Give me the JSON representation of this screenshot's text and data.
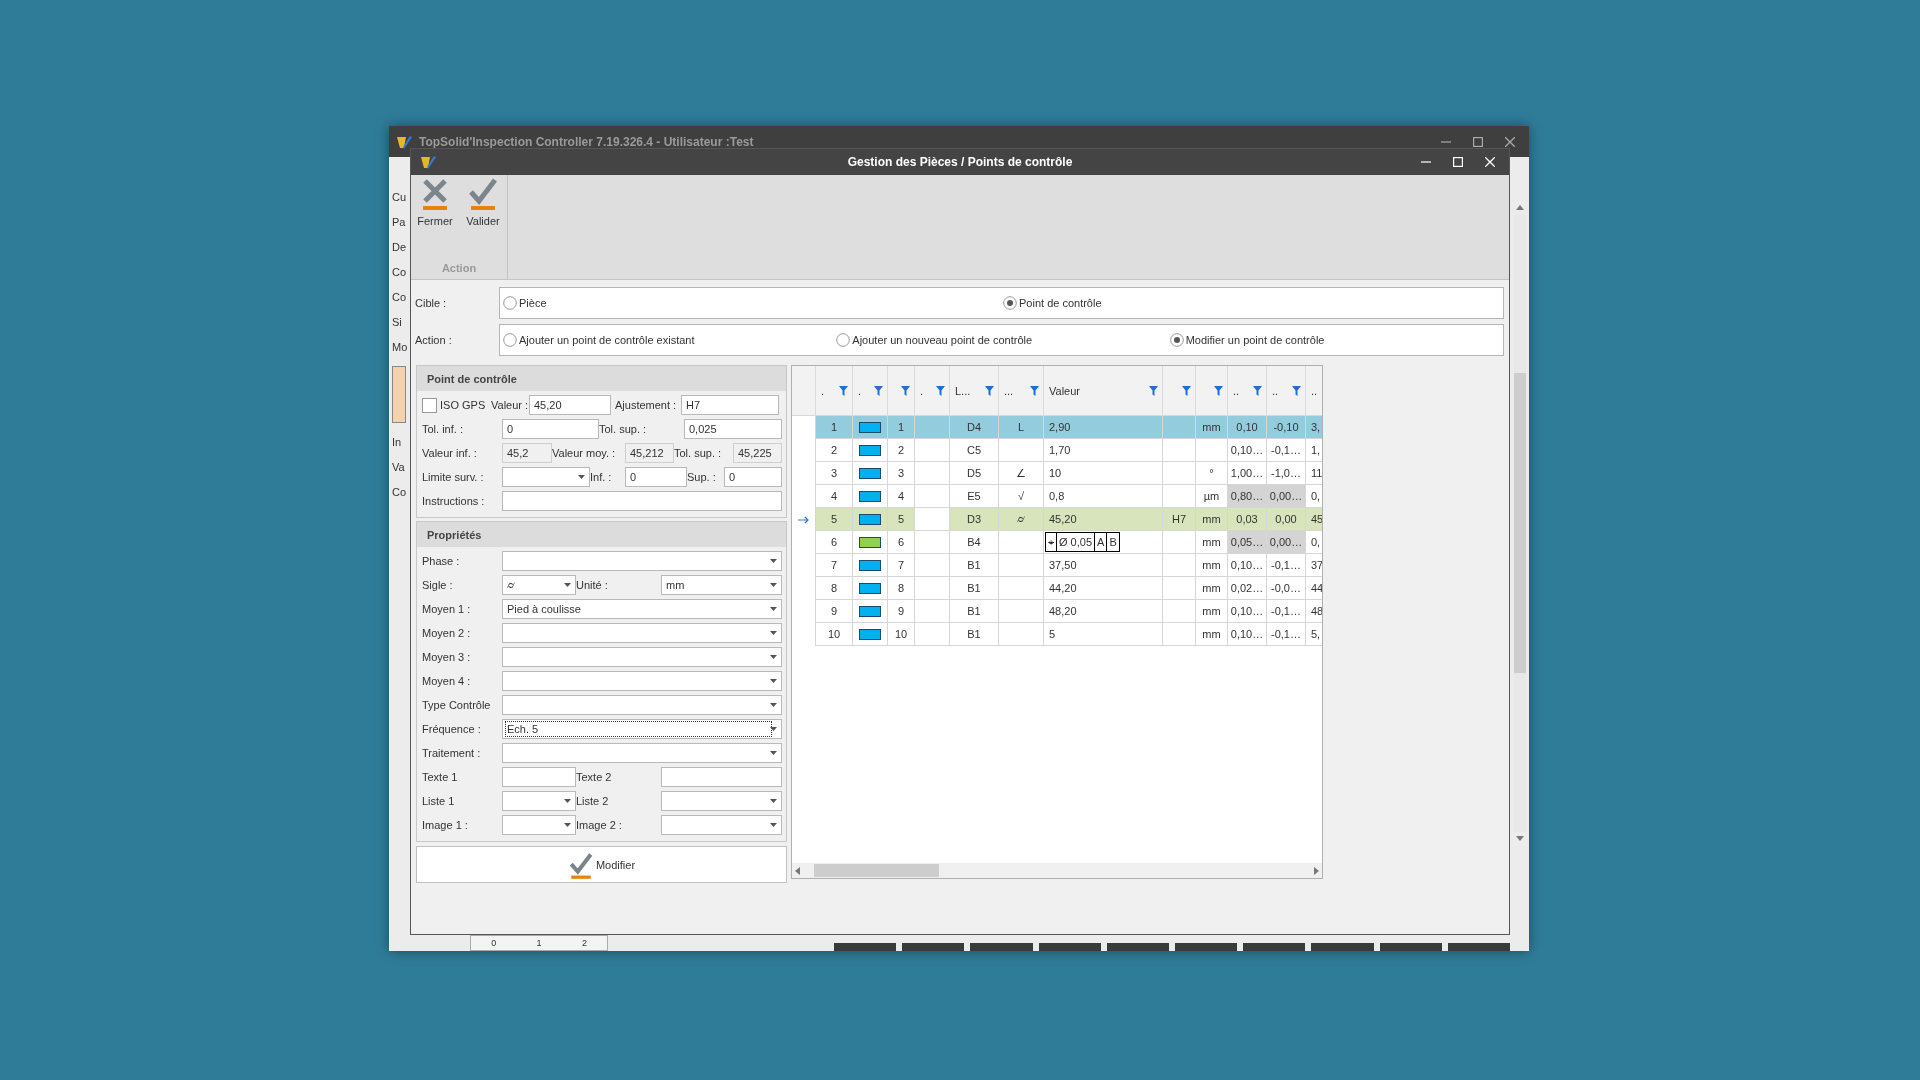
{
  "background_window": {
    "title": "TopSolid'Inspection Controller 7.19.326.4 - Utilisateur :Test",
    "side_labels": [
      "Cu",
      "Pa",
      "De",
      "Co",
      "Co",
      "Si",
      "Mo",
      "In",
      "Va",
      "Co"
    ],
    "ruler_labels": [
      "0",
      "1",
      "2"
    ]
  },
  "dialog": {
    "title": "Gestion des Pièces / Points de contrôle"
  },
  "ribbon": {
    "group": "Action",
    "buttons": [
      {
        "kind": "close",
        "label": "Fermer"
      },
      {
        "kind": "check",
        "label": "Valider"
      }
    ]
  },
  "target": {
    "label": "Cible :",
    "options": [
      {
        "label": "Pièce",
        "selected": false
      },
      {
        "label": "Point de contrôle",
        "selected": true
      }
    ]
  },
  "action": {
    "label": "Action :",
    "options": [
      {
        "label": "Ajouter un point de contrôle existant",
        "selected": false
      },
      {
        "label": "Ajouter un nouveau point de contrôle",
        "selected": false
      },
      {
        "label": "Modifier un point de contrôle",
        "selected": true
      }
    ]
  },
  "control_point": {
    "title": "Point de contrôle",
    "rows": [
      {
        "fields": [
          {
            "kind": "checkbox",
            "label": "ISO GPS",
            "checked": false
          },
          {
            "kind": "input",
            "label": "Valeur :",
            "value": "45,20"
          },
          {
            "kind": "input",
            "label": "Ajustement :",
            "value": "H7"
          }
        ]
      },
      {
        "fields": [
          {
            "kind": "input",
            "label": "Tol. inf. :",
            "value": "0"
          },
          {
            "kind": "input",
            "label": "Tol. sup. :",
            "value": "0,025"
          }
        ]
      },
      {
        "fields": [
          {
            "kind": "readonly",
            "label": "Valeur inf. :",
            "value": "45,2"
          },
          {
            "kind": "readonly",
            "label": "Valeur moy. :",
            "value": "45,212"
          },
          {
            "kind": "readonly",
            "label": "Tol. sup. :",
            "value": "45,225"
          }
        ]
      },
      {
        "fields": [
          {
            "kind": "combo",
            "label": "Limite surv. :"
          },
          {
            "kind": "input",
            "label": "Inf. :",
            "value": "0"
          },
          {
            "kind": "input",
            "label": "Sup. :",
            "value": "0"
          }
        ]
      },
      {
        "fields": [
          {
            "kind": "input",
            "label": "Instructions :"
          }
        ]
      }
    ]
  },
  "properties": {
    "title": "Propriétés",
    "rows": [
      {
        "fields": [
          {
            "kind": "combo",
            "label": "Phase :",
            "focused": false
          }
        ]
      },
      {
        "fields": [
          {
            "kind": "combo",
            "label": "Sigle :",
            "value": "⌭",
            "focused": false
          },
          {
            "kind": "combo",
            "label": "Unité :",
            "value": "mm",
            "focused": false
          }
        ]
      },
      {
        "fields": [
          {
            "kind": "combo",
            "label": "Moyen 1 :",
            "value": "Pied à coulisse",
            "focused": false
          }
        ]
      },
      {
        "fields": [
          {
            "kind": "combo",
            "label": "Moyen 2 :",
            "focused": false
          }
        ]
      },
      {
        "fields": [
          {
            "kind": "combo",
            "label": "Moyen 3 :",
            "focused": false
          }
        ]
      },
      {
        "fields": [
          {
            "kind": "combo",
            "label": "Moyen 4 :",
            "focused": false
          }
        ]
      },
      {
        "fields": [
          {
            "kind": "combo",
            "label": "Type Contrôle",
            "focused": false
          }
        ]
      },
      {
        "fields": [
          {
            "kind": "combo",
            "label": "Fréquence :",
            "value": "Ech. 5",
            "focused": true
          }
        ]
      },
      {
        "fields": [
          {
            "kind": "combo",
            "label": "Traitement :",
            "focused": false
          }
        ]
      },
      {
        "fields": [
          {
            "kind": "input",
            "label": "Texte 1",
            "focused": false
          },
          {
            "kind": "input",
            "label": "Texte 2",
            "focused": false
          }
        ]
      },
      {
        "fields": [
          {
            "kind": "combo",
            "label": "Liste 1",
            "focused": false
          },
          {
            "kind": "combo",
            "label": "Liste 2",
            "focused": false
          }
        ]
      },
      {
        "fields": [
          {
            "kind": "combo",
            "label": "Image 1 :",
            "focused": false
          },
          {
            "kind": "combo",
            "label": "Image 2 :",
            "focused": false
          }
        ]
      }
    ]
  },
  "modify_button": {
    "label": "Modifier"
  },
  "table": {
    "columns": [
      {
        "label": ".",
        "filter": true
      },
      {
        "label": ".",
        "filter": true
      },
      {
        "filter": true
      },
      {
        "label": ".",
        "filter": true
      },
      {
        "label": "L...",
        "filter": true
      },
      {
        "label": "...",
        "filter": true
      },
      {
        "label": "Valeur",
        "filter": true
      },
      {
        "filter": true
      },
      {
        "filter": true
      },
      {
        "label": "..",
        "filter": true
      },
      {
        "label": "..",
        "filter": true
      },
      {
        "label": "..",
        "filter": false
      }
    ],
    "rows": [
      {
        "kind": "text",
        "index": "1",
        "color": "#00b0f0",
        "number": "1",
        "location": "D4",
        "symbol": "L",
        "value": "2,90",
        "unit": "mm",
        "column_10": "0,10",
        "column_11": "-0,10",
        "column_12": "3,",
        "selected": true,
        "current": false,
        "grayed": false
      },
      {
        "kind": "text",
        "index": "2",
        "color": "#00b0f0",
        "number": "2",
        "location": "C5",
        "value": "1,70",
        "column_10": "0,10…",
        "column_11": "-0,1…",
        "column_12": "1,",
        "selected": false,
        "current": false,
        "grayed": false
      },
      {
        "kind": "text",
        "index": "3",
        "color": "#00b0f0",
        "number": "3",
        "location": "D5",
        "symbol": "∠",
        "value": "10",
        "unit": "°",
        "column_10": "1,00…",
        "column_11": "-1,0…",
        "column_12": "11",
        "selected": false,
        "current": false,
        "grayed": false
      },
      {
        "kind": "text",
        "index": "4",
        "color": "#00b0f0",
        "number": "4",
        "location": "E5",
        "symbol": "√",
        "value": "0,8",
        "unit": "µm",
        "column_10": "0,80…",
        "column_11": "0,00…",
        "column_12": "0,",
        "selected": false,
        "current": false,
        "grayed": true
      },
      {
        "kind": "text",
        "index": "5",
        "color": "#00b0f0",
        "number": "5",
        "location": "D3",
        "symbol": "⌭",
        "value": "45,20",
        "fit": "H7",
        "unit": "mm",
        "column_10": "0,03",
        "column_11": "0,00",
        "column_12": "45",
        "selected": false,
        "current": true,
        "grayed": false
      },
      {
        "kind": "frame",
        "index": "6",
        "color": "#92d050",
        "number": "6",
        "location": "B4",
        "frame": [
          "⌖",
          "Ø 0,05",
          "A",
          "B"
        ],
        "unit": "mm",
        "column_10": "0,05…",
        "column_11": "0,00…",
        "column_12": "0,",
        "selected": false,
        "current": false,
        "grayed": true
      },
      {
        "kind": "text",
        "index": "7",
        "color": "#00b0f0",
        "number": "7",
        "location": "B1",
        "value": "37,50",
        "unit": "mm",
        "column_10": "0,10…",
        "column_11": "-0,1…",
        "column_12": "37",
        "selected": false,
        "current": false,
        "grayed": false
      },
      {
        "kind": "text",
        "index": "8",
        "color": "#00b0f0",
        "number": "8",
        "location": "B1",
        "value": "44,20",
        "unit": "mm",
        "column_10": "0,02…",
        "column_11": "-0,0…",
        "column_12": "44",
        "selected": false,
        "current": false,
        "grayed": false
      },
      {
        "kind": "text",
        "index": "9",
        "color": "#00b0f0",
        "number": "9",
        "location": "B1",
        "value": "48,20",
        "unit": "mm",
        "column_10": "0,10…",
        "column_11": "-0,1…",
        "column_12": "48",
        "selected": false,
        "current": false,
        "grayed": false
      },
      {
        "kind": "text",
        "index": "10",
        "color": "#00b0f0",
        "number": "10",
        "location": "B1",
        "value": "5",
        "unit": "mm",
        "column_10": "0,10…",
        "column_11": "-0,1…",
        "column_12": "5,",
        "selected": false,
        "current": false,
        "grayed": false
      }
    ]
  }
}
